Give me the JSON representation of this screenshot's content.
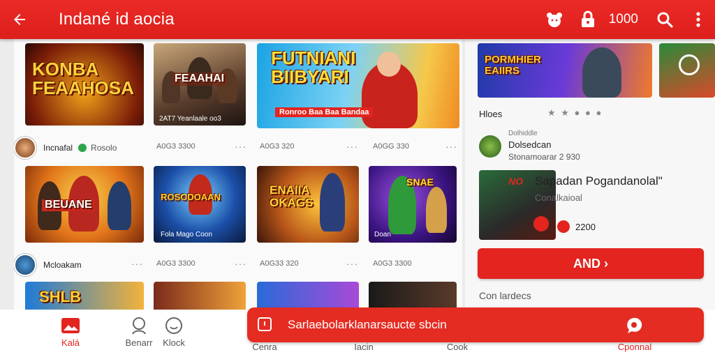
{
  "topbar": {
    "title": "Indané id aocia",
    "coins": "1000",
    "icons": [
      "back-arrow-icon",
      "bear-icon",
      "lock-icon",
      "search-icon",
      "more-vertical-icon"
    ]
  },
  "feed": {
    "featured": [
      {
        "label": "KONBA\nFEAAHOSA"
      },
      {
        "label": "FEAAHAI",
        "caption": "2AT7  Yeanlaale oo3"
      },
      {
        "label": "FUTNIANI\nBIIBYARI",
        "caption": "Ronroo Baa Baa Bandaa"
      }
    ],
    "row1": {
      "channel": "Incnafal",
      "verified_label": "Rosolo",
      "metas": [
        "A0G3 3300",
        "A0G3 320",
        "A0GG 330"
      ],
      "tiles": [
        {
          "label": "BEUANE"
        },
        {
          "label": "ROSODOAAN",
          "caption": "Fola Mago Coon"
        },
        {
          "label": "ENAIIA\nOKAGS"
        },
        {
          "label": "SNAE",
          "caption": "Doan"
        }
      ]
    },
    "row2": {
      "channel": "Mcloakam",
      "metas": [
        "A0G3 3300",
        "A0G33 320",
        "A0G3 3300"
      ],
      "tiles": [
        {
          "label": "SHLB"
        }
      ]
    }
  },
  "right": {
    "promo_label": "PORMHIER\nEAIIRS",
    "section_label": "Hloes",
    "rating_dots": "★ ★ ● ● ●",
    "profile_name": "Dolsedcan",
    "profile_handle": "Dolhiddle",
    "profile_meta": "Stonamoarar 2 930",
    "card_title": "Sapadan Pogandanolal\"",
    "card_sub": "Conalkaioal",
    "card_tag": "NO",
    "video_count": "2200",
    "cta_label": "AND ›",
    "footer_label": "Con lardecs",
    "colors": {
      "brand": "#e3241f",
      "topbar": "#ea2a26"
    }
  },
  "bottomnav": {
    "items": [
      {
        "label": "Kalá",
        "icon": "image-icon"
      },
      {
        "label": "Benarr",
        "icon": "chat-people-icon"
      },
      {
        "label": "Klock",
        "icon": "smile-icon"
      },
      {
        "label": "Cenra",
        "icon": "calendar-icon"
      },
      {
        "label": "Iacin",
        "icon": "home-icon"
      },
      {
        "label": "Cook",
        "icon": "cook-icon"
      },
      {
        "label": "Cponnal",
        "icon": "chat-bubble-icon"
      }
    ],
    "banner_text": "Sarlaebolarklanarsaucte sbcin"
  }
}
